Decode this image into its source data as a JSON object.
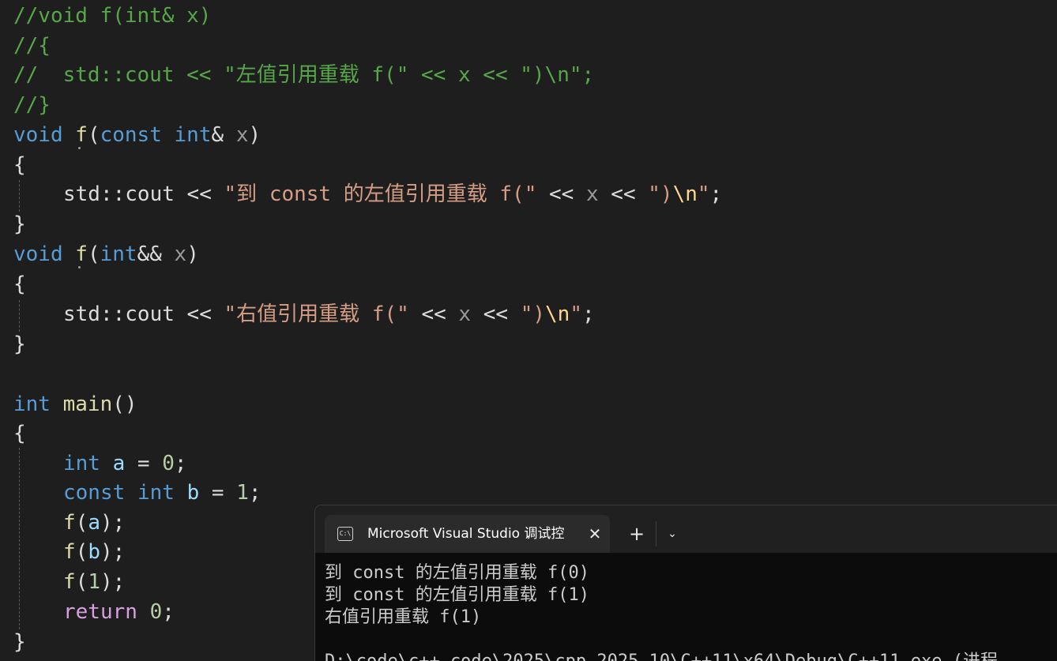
{
  "editor": {
    "comment_lines": [
      "//void f(int& x)",
      "//{",
      "//  std::cout << \"左值引用重载 f(\" << x << \")\\n\";",
      "//}"
    ],
    "tokens": {
      "void": "void",
      "int": "int",
      "const": "const",
      "f": "f",
      "x": "x",
      "main": "main",
      "return": "return",
      "a": "a",
      "b": "b",
      "std_cout": "std::cout",
      "lshift": " << ",
      "open_brace": "{",
      "close_brace": "}",
      "open_paren": "(",
      "close_paren": ")",
      "amp": "&",
      "ampamp": "&&",
      "semicolon": ";",
      "assign": " = ",
      "str_open_const": "\"到 const 的左值引用重载 f(\"",
      "str_open_rvalue": "\"右值引用重载 f(\"",
      "str_close_quote": "\"",
      "str_close_paren": ")",
      "str_newline": "\\n",
      "zero": "0",
      "one": "1",
      "empty_parens": "()"
    }
  },
  "terminal": {
    "tab_icon_text": "C:\\",
    "tab_title": "Microsoft Visual Studio 调试控",
    "close_symbol": "✕",
    "new_tab_symbol": "+",
    "dropdown_symbol": "⌄",
    "output_lines": [
      "到 const 的左值引用重载 f(0)",
      "到 const 的左值引用重载 f(1)",
      "右值引用重载 f(1)",
      "",
      "D:\\code\\c++-code\\2025\\cpp-2025-10\\C++11\\x64\\Debug\\C++11.exe (进程"
    ]
  }
}
